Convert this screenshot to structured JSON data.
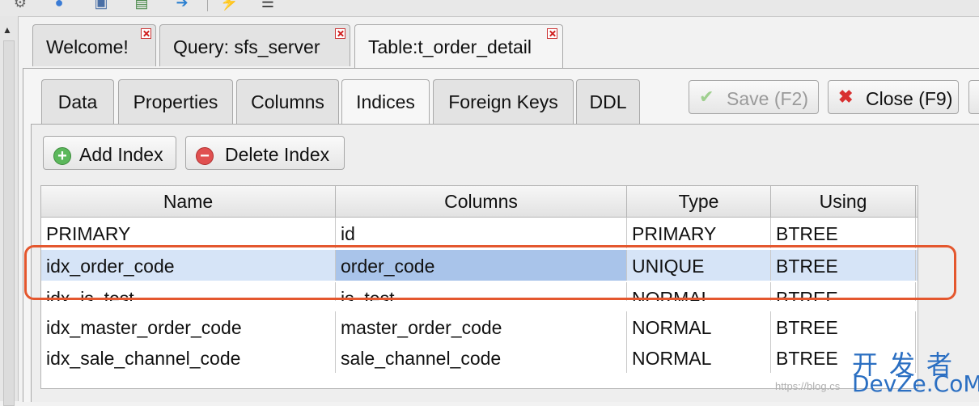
{
  "toolbar": {
    "icons": [
      "gear-icon",
      "users-icon",
      "save-icon",
      "add-table-icon",
      "export-icon",
      "lightning-icon",
      "list-icon"
    ]
  },
  "outer_tabs": [
    {
      "label": "Welcome!"
    },
    {
      "label": "Query: sfs_server"
    },
    {
      "label": "Table:t_order_detail",
      "active": true
    }
  ],
  "inner_tabs": [
    {
      "label": "Data"
    },
    {
      "label": "Properties"
    },
    {
      "label": "Columns"
    },
    {
      "label": "Indices",
      "active": true
    },
    {
      "label": "Foreign Keys"
    },
    {
      "label": "DDL"
    }
  ],
  "actions": {
    "save_label": "Save (F2)",
    "close_label": "Close (F9)",
    "add_index_label": "Add Index",
    "delete_index_label": "Delete Index"
  },
  "table": {
    "headers": [
      "Name",
      "Columns",
      "Type",
      "Using"
    ],
    "rows": [
      [
        "PRIMARY",
        "id",
        "PRIMARY",
        "BTREE"
      ],
      [
        "idx_order_code",
        "order_code",
        "UNIQUE",
        "BTREE"
      ],
      [
        "idx_is_test",
        "is_test",
        "NORMAL",
        "BTREE"
      ],
      [
        "idx_master_order_code",
        "master_order_code",
        "NORMAL",
        "BTREE"
      ],
      [
        "idx_sale_channel_code",
        "sale_channel_code",
        "NORMAL",
        "BTREE"
      ]
    ],
    "selected_row": 1
  },
  "watermark": {
    "cn": "开发者",
    "brand": "DevZe.CoM",
    "url": "https://blog.cs"
  },
  "colors": {
    "annotation": "#e4572e",
    "selection": "#d6e4f7",
    "brand": "#2b6fc2"
  }
}
